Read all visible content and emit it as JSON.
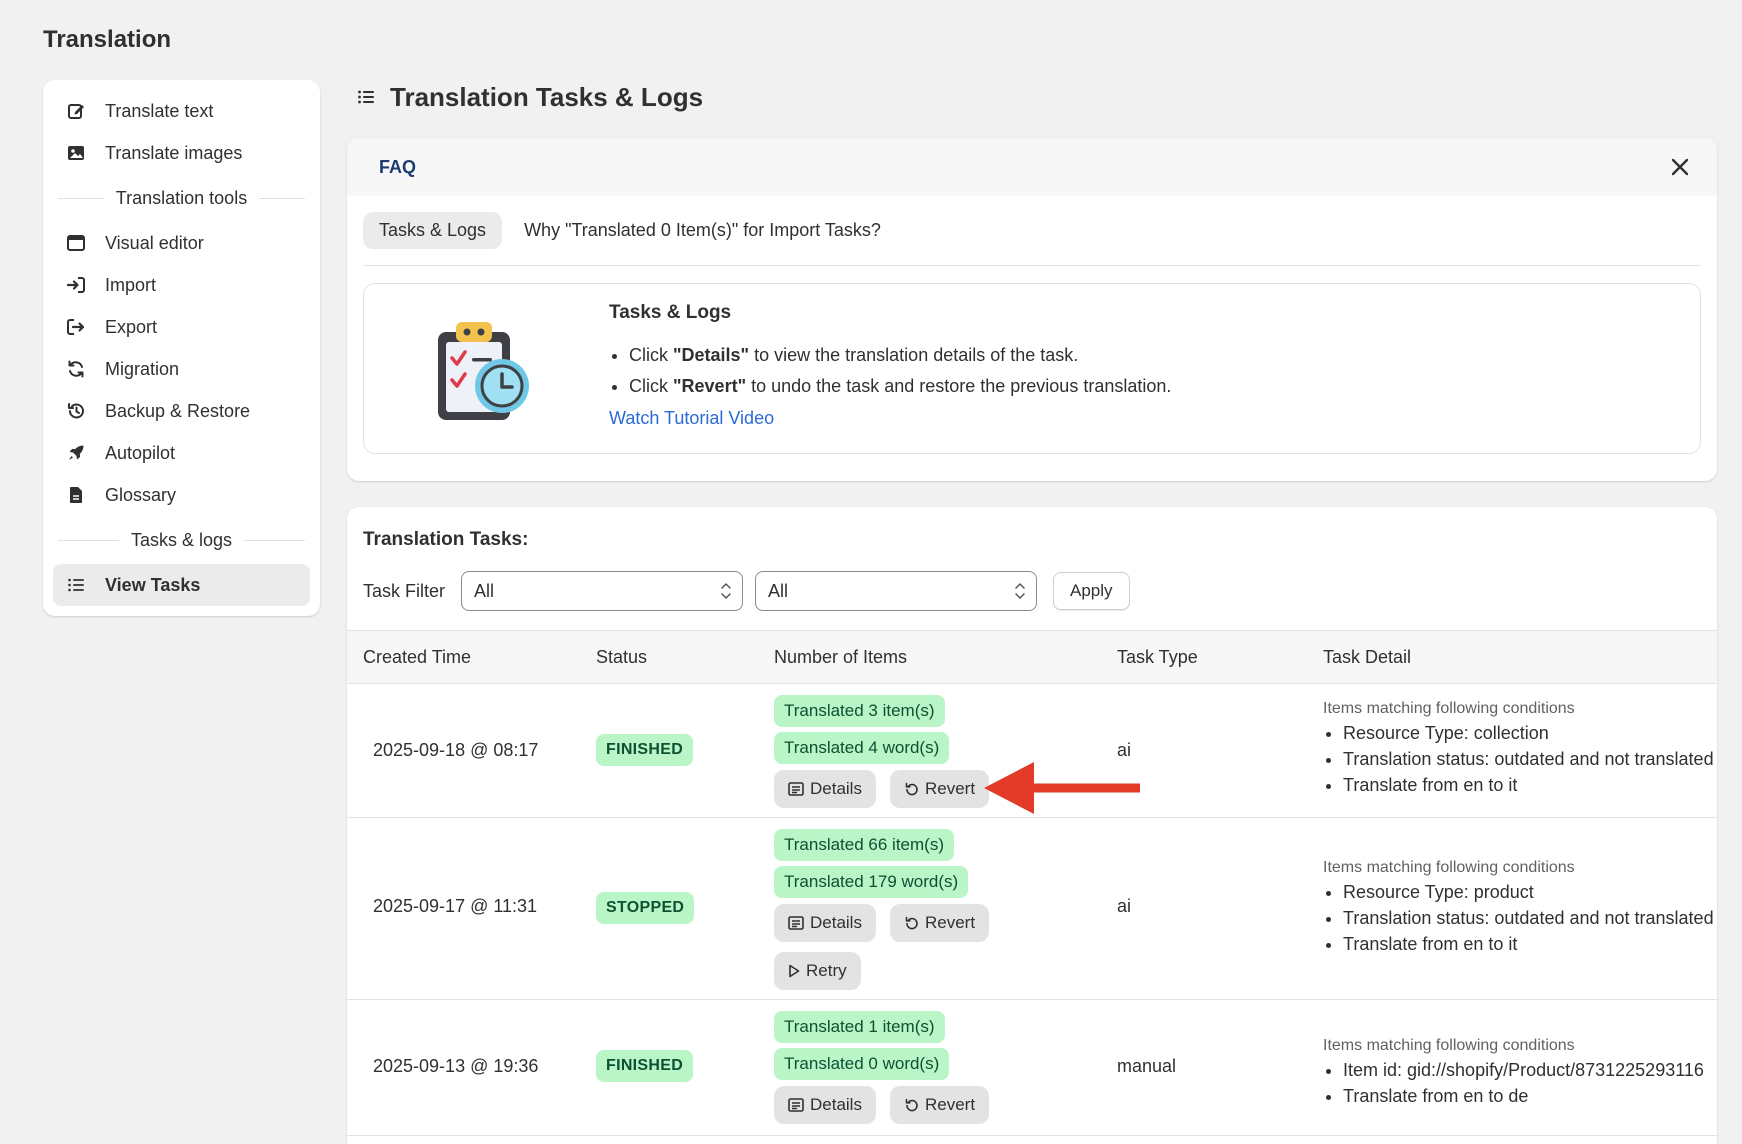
{
  "app_title": "Translation",
  "sidebar": {
    "items_top": [
      {
        "label": "Translate text",
        "icon": "edit-icon"
      },
      {
        "label": "Translate images",
        "icon": "image-icon"
      }
    ],
    "section_tools": "Translation tools",
    "items_tools": [
      {
        "label": "Visual editor",
        "icon": "browser-window-icon"
      },
      {
        "label": "Import",
        "icon": "import-icon"
      },
      {
        "label": "Export",
        "icon": "export-icon"
      },
      {
        "label": "Migration",
        "icon": "refresh-icon"
      },
      {
        "label": "Backup & Restore",
        "icon": "history-icon"
      },
      {
        "label": "Autopilot",
        "icon": "rocket-icon"
      },
      {
        "label": "Glossary",
        "icon": "document-icon"
      }
    ],
    "section_logs": "Tasks & logs",
    "items_logs": [
      {
        "label": "View Tasks",
        "icon": "list-icon",
        "active": true
      }
    ]
  },
  "page_heading": "Translation Tasks & Logs",
  "faq": {
    "title": "FAQ",
    "tab": "Tasks & Logs",
    "question": "Why \"Translated 0 Item(s)\" for Import Tasks?",
    "body_title": "Tasks & Logs",
    "bullet1_pre": "Click ",
    "bullet1_bold": "\"Details\"",
    "bullet1_post": " to view the translation details of the task.",
    "bullet2_pre": "Click ",
    "bullet2_bold": "\"Revert\"",
    "bullet2_post": " to undo the task and restore the previous translation.",
    "link": "Watch Tutorial Video"
  },
  "tasks": {
    "title": "Translation Tasks:",
    "filter_label": "Task Filter",
    "filter1_value": "All",
    "filter2_value": "All",
    "apply_label": "Apply",
    "columns": {
      "created": "Created Time",
      "status": "Status",
      "items": "Number of Items",
      "type": "Task Type",
      "detail": "Task Detail"
    },
    "rows": [
      {
        "created": "2025-09-18 @ 08:17",
        "status": "FINISHED",
        "items_tag": "Translated 3 item(s)",
        "words_tag": "Translated 4 word(s)",
        "details_label": "Details",
        "revert_label": "Revert",
        "type": "ai",
        "detail_head": "Items matching following conditions",
        "detail_items": [
          "Resource Type: collection",
          "Translation status: outdated and not translated",
          "Translate from en to it"
        ]
      },
      {
        "created": "2025-09-17 @ 11:31",
        "status": "STOPPED",
        "items_tag": "Translated 66 item(s)",
        "words_tag": "Translated 179 word(s)",
        "details_label": "Details",
        "revert_label": "Revert",
        "retry_label": "Retry",
        "type": "ai",
        "detail_head": "Items matching following conditions",
        "detail_items": [
          "Resource Type: product",
          "Translation status: outdated and not translated",
          "Translate from en to it"
        ]
      },
      {
        "created": "2025-09-13 @ 19:36",
        "status": "FINISHED",
        "items_tag": "Translated 1 item(s)",
        "words_tag": "Translated 0 word(s)",
        "details_label": "Details",
        "revert_label": "Revert",
        "type": "manual",
        "detail_head": "Items matching following conditions",
        "detail_items": [
          "Item id: gid://shopify/Product/8731225293116",
          "Translate from en to de"
        ]
      }
    ]
  },
  "colors": {
    "badge_bg": "#b9f5c6",
    "badge_text": "#0c5132",
    "link": "#2a6bd4",
    "annotation_arrow": "#e23b2a"
  }
}
